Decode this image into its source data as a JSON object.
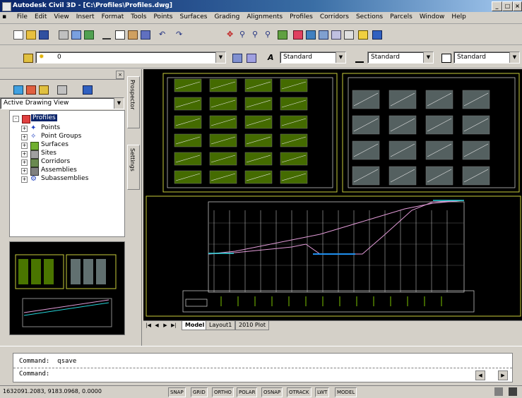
{
  "window": {
    "title": "Autodesk Civil 3D - [C:\\Profiles\\Profiles.dwg]"
  },
  "menu": [
    "File",
    "Edit",
    "View",
    "Insert",
    "Format",
    "Tools",
    "Points",
    "Surfaces",
    "Grading",
    "Alignments",
    "Profiles",
    "Corridors",
    "Sections",
    "Parcels",
    "Window",
    "Help"
  ],
  "toolbar2": {
    "layer_value": "0",
    "textstyle_value": "Standard",
    "dimstyle_value": "Standard",
    "tablestyle_value": "Standard"
  },
  "left_panel": {
    "view_select": "Active Drawing View",
    "tree": [
      {
        "label": "Profiles",
        "icon": "drawing-icon",
        "expander": "-",
        "indent": 0
      },
      {
        "label": "Points",
        "icon": "points-icon",
        "expander": "+",
        "indent": 1
      },
      {
        "label": "Point Groups",
        "icon": "point-groups-icon",
        "expander": "+",
        "indent": 1
      },
      {
        "label": "Surfaces",
        "icon": "surfaces-icon",
        "expander": "+",
        "indent": 1
      },
      {
        "label": "Sites",
        "icon": "sites-icon",
        "expander": "+",
        "indent": 1
      },
      {
        "label": "Corridors",
        "icon": "corridors-icon",
        "expander": "+",
        "indent": 1
      },
      {
        "label": "Assemblies",
        "icon": "assemblies-icon",
        "expander": "+",
        "indent": 1
      },
      {
        "label": "Subassemblies",
        "icon": "subassemblies-icon",
        "expander": "+",
        "indent": 1
      }
    ],
    "side_tabs": [
      "Prospector",
      "Settings"
    ]
  },
  "layout_tabs": [
    "Model",
    "Layout1",
    "2010 Plot"
  ],
  "command": {
    "line1": "Command:  qsave",
    "line2": "Command:"
  },
  "status": {
    "coordinates": "1632091.2083, 9183.0968, 0.0000",
    "toggles": [
      "SNAP",
      "GRID",
      "ORTHO",
      "POLAR",
      "OSNAP",
      "OTRACK",
      "LWT",
      "MODEL"
    ]
  },
  "colors": {
    "accent_green": "#7cc300",
    "profile_cyan": "#24d3d8",
    "profile_pink": "#e29bd8",
    "border_yellow": "#c8cc3a"
  }
}
